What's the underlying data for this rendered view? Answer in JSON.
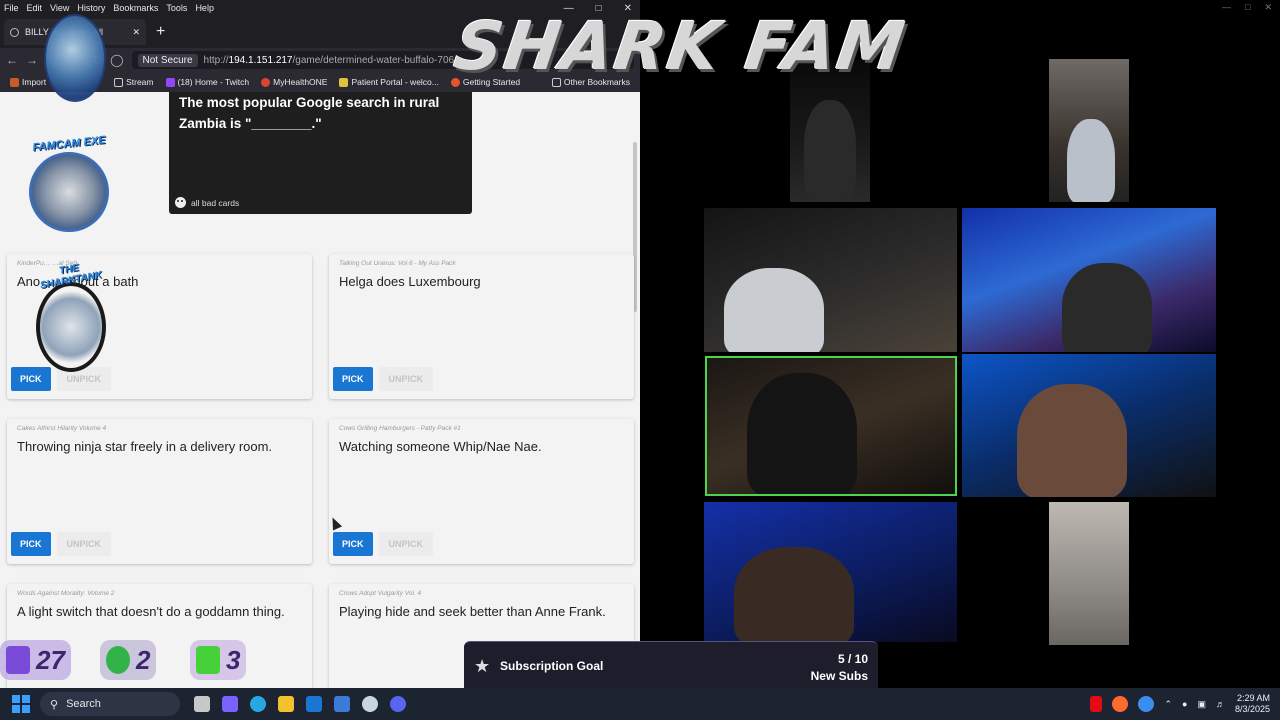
{
  "menubar": {
    "items": [
      "File",
      "Edit",
      "View",
      "History",
      "Bookmarks",
      "Tools",
      "Help"
    ]
  },
  "tab": {
    "title": "BILLY B…              ame | All"
  },
  "address": {
    "security": "Not Secure",
    "host": "194.1.151.217",
    "scheme": "http://",
    "path": "/game/determined-water-buffalo-7061"
  },
  "bookmarks": [
    "Import",
    "Stream",
    "(18) Home - Twitch",
    "MyHealthONE",
    "Patient Portal - welco...",
    "Getting Started",
    "Other Bookmarks"
  ],
  "black_card": {
    "prompt": "The most popular Google search in rural Zambia is \"________.\"",
    "pack": "all bad cards"
  },
  "cards": [
    {
      "source": "KinderPu…                    …al Set)",
      "answer": "Ano…              …thout a bath"
    },
    {
      "source": "Talking Out Uranus: Vol 6 - My Ass Pack",
      "answer": "Helga does Luxembourg"
    },
    {
      "source": "Cakes Athirst Hilarity Volume 4",
      "answer": "Throwing ninja star freely in a delivery room."
    },
    {
      "source": "Cows Grilling Hamburgers - Patty Pack #1",
      "answer": "Watching someone Whip/Nae Nae."
    },
    {
      "source": "Words Against Morality: Volume 2",
      "answer": "A light switch that doesn't do a goddamn thing."
    },
    {
      "source": "Crows Adopt Vulgarity Vol. 4",
      "answer": "Playing hide and seek better than Anne Frank."
    }
  ],
  "buttons": {
    "pick": "PICK",
    "unpick": "UNPICK"
  },
  "overlay": {
    "title": "SHARK FAM",
    "famcam_label": "FAMCAM EXE",
    "sharktank_label": "THE SHARKTANK",
    "counters": {
      "subs": "27",
      "follows": "2",
      "kicks": "3"
    }
  },
  "subscription_goal": {
    "title": "Subscription Goal",
    "count": "5 / 10",
    "unit": "New Subs",
    "progress": 0.5,
    "milestones": [
      0.25,
      0.5,
      0.75
    ]
  },
  "taskbar": {
    "search": "Search",
    "time": "2:29 AM",
    "date": "8/3/2025"
  }
}
